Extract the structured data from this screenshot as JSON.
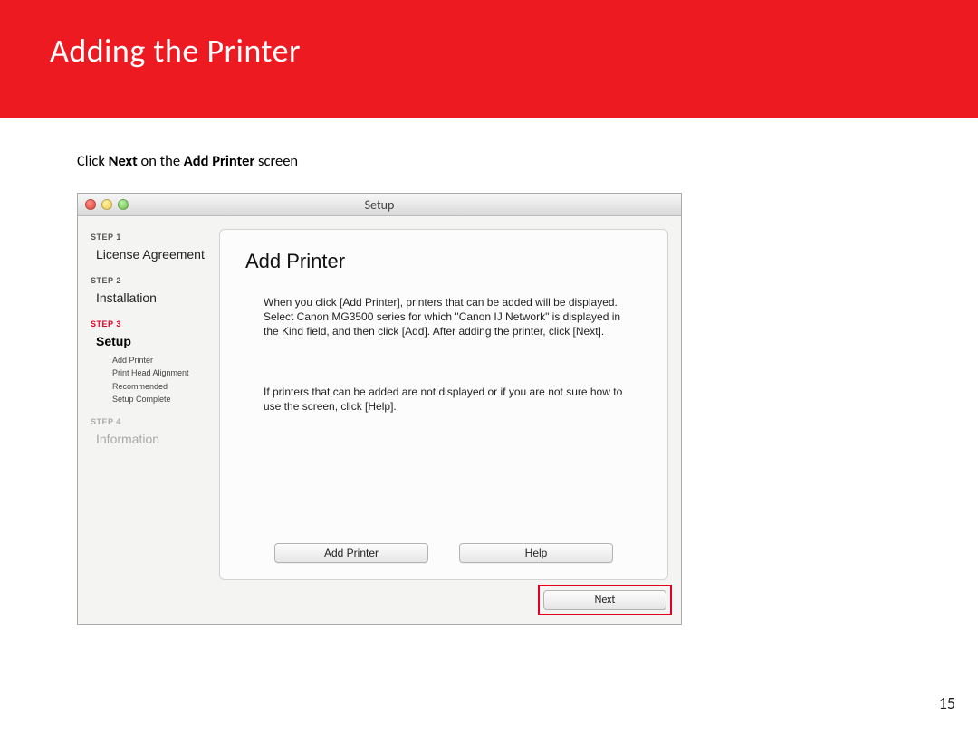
{
  "page": {
    "title": "Adding  the Printer",
    "number": "15"
  },
  "instruction": {
    "pre": "Click ",
    "b1": "Next",
    "mid": " on the ",
    "b2": "Add Printer",
    "post": " screen"
  },
  "window": {
    "title": "Setup",
    "sidebar": {
      "steps": [
        {
          "label": "STEP 1",
          "title": "License Agreement"
        },
        {
          "label": "STEP 2",
          "title": "Installation"
        },
        {
          "label": "STEP 3",
          "title": "Setup"
        },
        {
          "label": "STEP 4",
          "title": "Information"
        }
      ],
      "substeps": {
        "a": "Add Printer",
        "b": "Print Head Alignment Recommended",
        "c": "Setup Complete"
      }
    },
    "content": {
      "heading": "Add Printer",
      "para1": "When you click [Add Printer], printers that can be added will be displayed. Select Canon MG3500 series for which \"Canon IJ Network\" is displayed in the Kind field, and then click [Add].\nAfter adding the printer, click [Next].",
      "para2": "If printers that can be added are not displayed or if you are not sure how to use the screen, click [Help].",
      "buttons": {
        "add": "Add Printer",
        "help": "Help"
      }
    },
    "next": "Next"
  }
}
